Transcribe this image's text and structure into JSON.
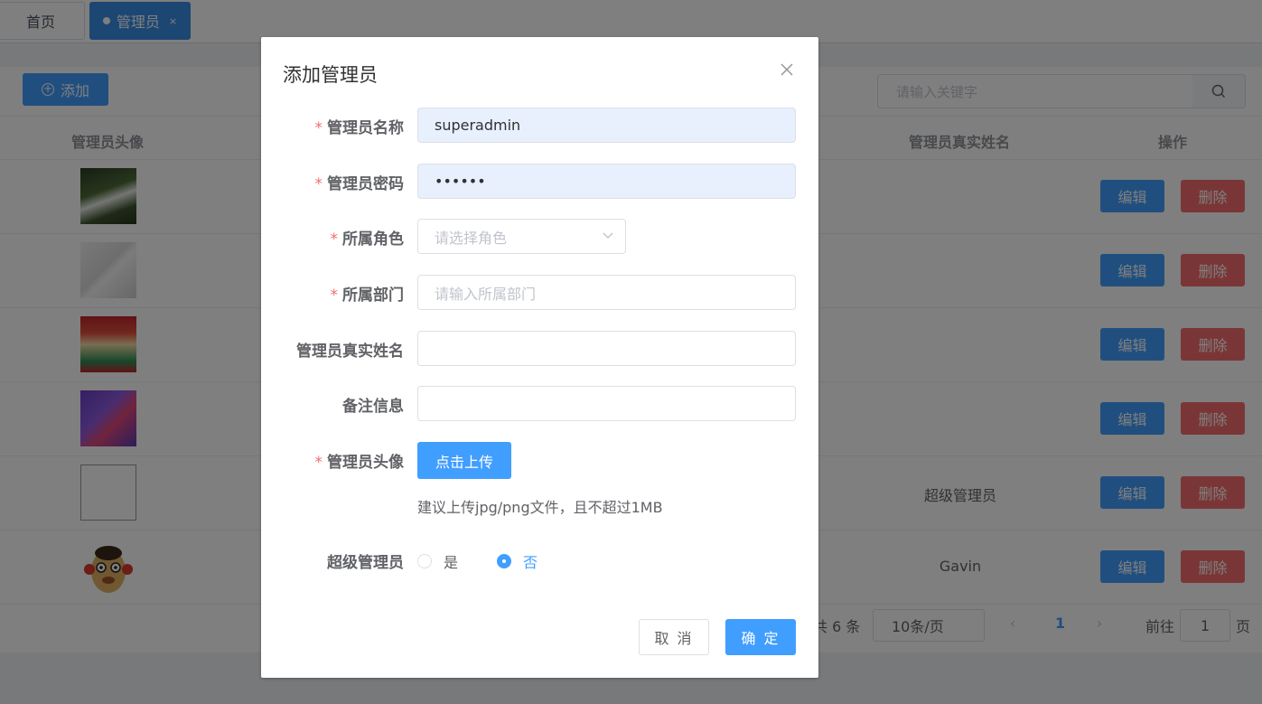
{
  "tabs": [
    {
      "label": "首页"
    },
    {
      "label": "管理员",
      "close": "×"
    }
  ],
  "toolbar": {
    "add_label": "添加",
    "search_placeholder": "请输入关键字"
  },
  "table": {
    "columns": {
      "avatar": "管理员头像",
      "real_name": "管理员真实姓名",
      "actions": "操作"
    },
    "rows": [
      {
        "real_name": "",
        "edit": "编辑",
        "delete": "删除"
      },
      {
        "real_name": "",
        "edit": "编辑",
        "delete": "删除"
      },
      {
        "real_name": "",
        "edit": "编辑",
        "delete": "删除"
      },
      {
        "real_name": "",
        "edit": "编辑",
        "delete": "删除"
      },
      {
        "real_name": "超级管理员",
        "edit": "编辑",
        "delete": "删除"
      },
      {
        "real_name": "Gavin",
        "edit": "编辑",
        "delete": "删除"
      }
    ]
  },
  "pagination": {
    "total": "共 6 条",
    "page_size": "10条/页",
    "current": "1",
    "goto_label": "前往",
    "goto_value": "1",
    "goto_unit": "页"
  },
  "dialog": {
    "title": "添加管理员",
    "fields": {
      "name_label": "管理员名称",
      "name_value": "superadmin",
      "password_label": "管理员密码",
      "password_value": "••••••",
      "role_label": "所属角色",
      "role_placeholder": "请选择角色",
      "dept_label": "所属部门",
      "dept_placeholder": "请输入所属部门",
      "realname_label": "管理员真实姓名",
      "remark_label": "备注信息",
      "avatar_label": "管理员头像",
      "upload_label": "点击上传",
      "upload_tip": "建议上传jpg/png文件，且不超过1MB",
      "super_label": "超级管理员",
      "super_yes": "是",
      "super_no": "否"
    },
    "cancel_label": "取 消",
    "ok_label": "确 定",
    "required_mark": "*"
  },
  "colors": {
    "primary": "#409eff",
    "danger": "#f56c6c"
  }
}
